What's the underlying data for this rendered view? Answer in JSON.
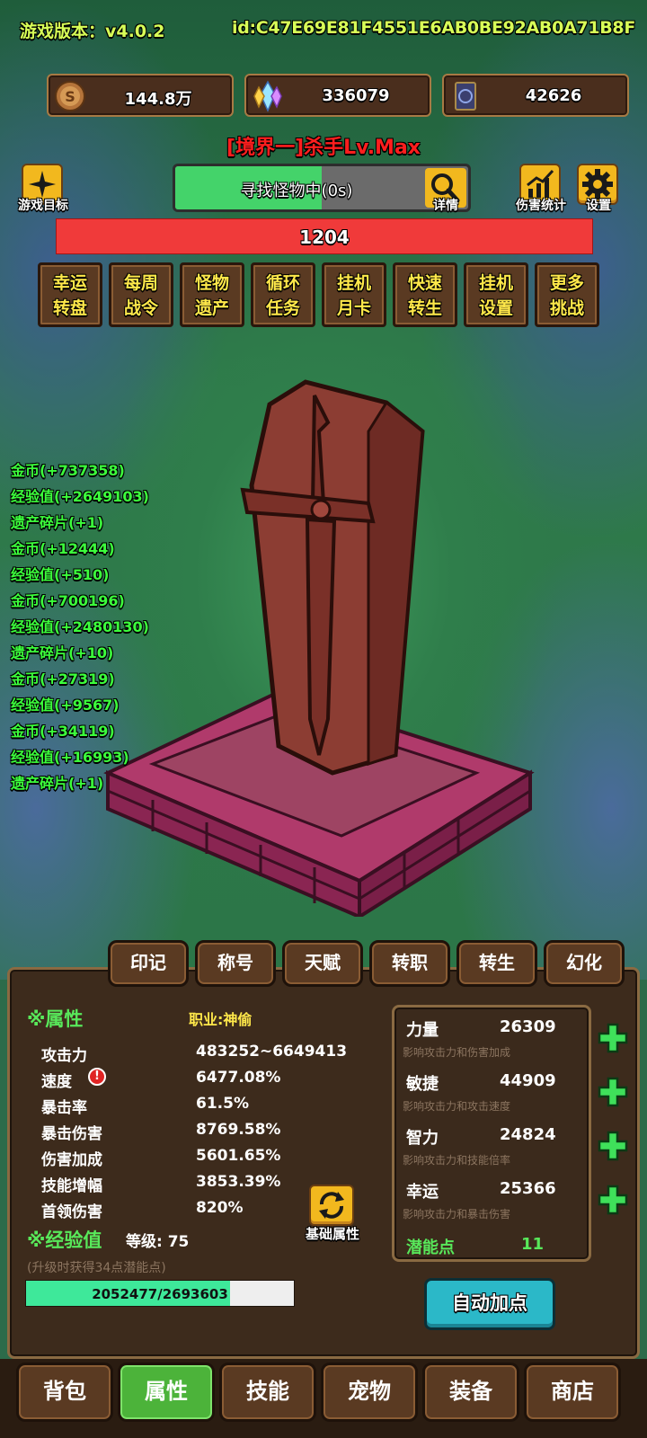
{
  "header": {
    "version": "游戏版本：v4.0.2",
    "user_id": "id:C47E69E81F4551E6AB0BE92AB0A71B8F"
  },
  "resources": {
    "gold": "144.8万",
    "crystal": "336079",
    "card": "42626"
  },
  "player_title": "[境界一]杀手Lv.Max",
  "toolbar": {
    "goal_label": "游戏目标",
    "search_text": "寻找怪物中(0s)",
    "search_progress": 0.5,
    "details_label": "详情",
    "damage_stats_label": "伤害统计",
    "settings_label": "设置"
  },
  "monster_hp": "1204",
  "menu": [
    {
      "line1": "幸运",
      "line2": "转盘"
    },
    {
      "line1": "每周",
      "line2": "战令"
    },
    {
      "line1": "怪物",
      "line2": "遗产"
    },
    {
      "line1": "循环",
      "line2": "任务"
    },
    {
      "line1": "挂机",
      "line2": "月卡"
    },
    {
      "line1": "快速",
      "line2": "转生"
    },
    {
      "line1": "挂机",
      "line2": "设置"
    },
    {
      "line1": "更多",
      "line2": "挑战"
    }
  ],
  "loot_log": [
    "金币(+737358)",
    "经验值(+2649103)",
    "遗产碎片(+1)",
    "金币(+12444)",
    "经验值(+510)",
    "金币(+700196)",
    "经验值(+2480130)",
    "遗产碎片(+10)",
    "金币(+27319)",
    "经验值(+9567)",
    "金币(+34119)",
    "经验值(+16993)",
    "遗产碎片(+1)"
  ],
  "sub_tabs": [
    "印记",
    "称号",
    "天赋",
    "转职",
    "转生",
    "幻化"
  ],
  "attributes": {
    "section_title": "※属性",
    "job": "职业:神偷",
    "rows": [
      {
        "label": "攻击力",
        "value": "483252~6649413"
      },
      {
        "label": "速度",
        "value": "6477.08%"
      },
      {
        "label": "暴击率",
        "value": "61.5%"
      },
      {
        "label": "暴击伤害",
        "value": "8769.58%"
      },
      {
        "label": "伤害加成",
        "value": "5601.65%"
      },
      {
        "label": "技能增幅",
        "value": "3853.39%"
      },
      {
        "label": "首领伤害",
        "value": "820%"
      }
    ],
    "alert_mark": "!",
    "basic_attr_label": "基础属性"
  },
  "experience": {
    "section_title": "※经验值",
    "level": "等级: 75",
    "hint": "(升级时获得34点潜能点)",
    "progress_text": "2052477/2693603",
    "progress": 0.762
  },
  "stats": [
    {
      "name": "力量",
      "value": "26309",
      "desc": "影响攻击力和伤害加成"
    },
    {
      "name": "敏捷",
      "value": "44909",
      "desc": "影响攻击力和攻击速度"
    },
    {
      "name": "智力",
      "value": "24824",
      "desc": "影响攻击力和技能倍率"
    },
    {
      "name": "幸运",
      "value": "25366",
      "desc": "影响攻击力和暴击伤害"
    }
  ],
  "potential": {
    "label": "潜能点",
    "value": "11"
  },
  "auto_assign_label": "自动加点",
  "bottom_nav": [
    "背包",
    "属性",
    "技能",
    "宠物",
    "装备",
    "商店"
  ],
  "active_nav_index": 1,
  "colors": {
    "accent_green": "#58e85a",
    "log_green": "#3cff3c",
    "title_red": "#ff1e1e",
    "menu_yellow": "#ffe84a",
    "hp_red": "#f03a3a"
  },
  "icons": [
    "coin-icon",
    "crystal-icon",
    "card-icon",
    "star-icon",
    "magnifier-icon",
    "chart-icon",
    "gear-icon",
    "refresh-icon",
    "plus-icon",
    "alert-icon"
  ]
}
